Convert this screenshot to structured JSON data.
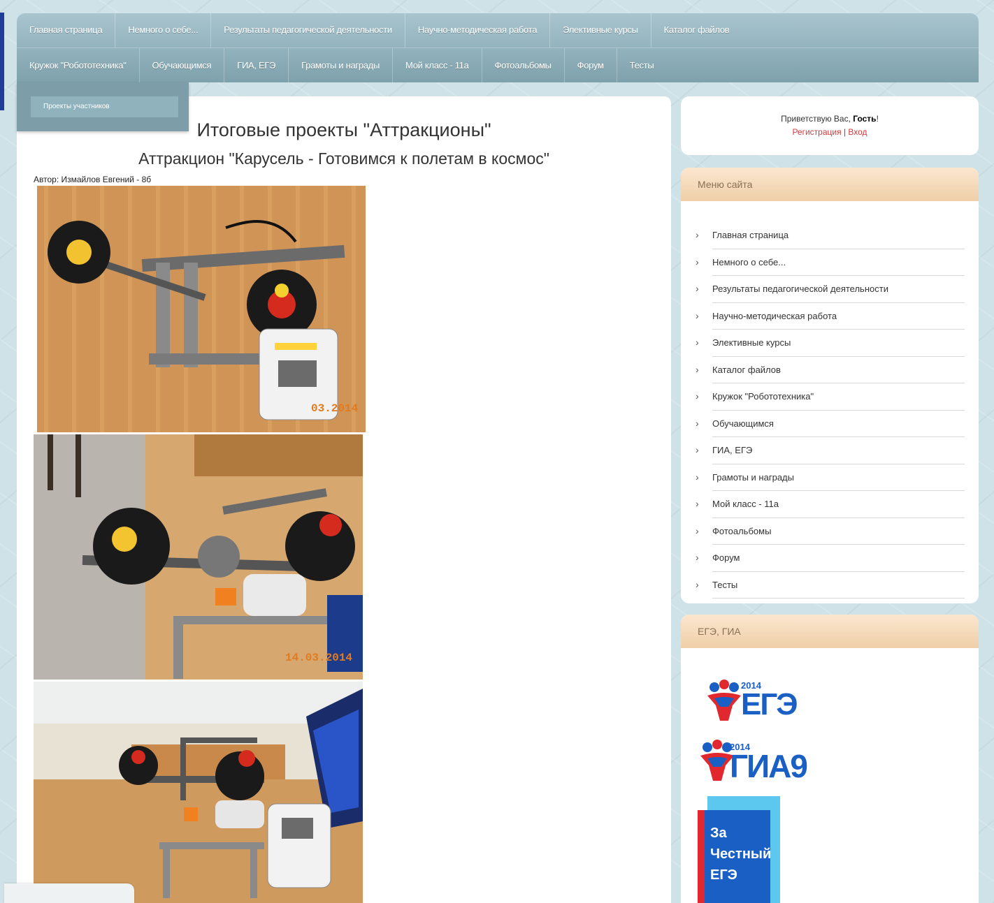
{
  "nav": {
    "row1": [
      "Главная страница",
      "Немного о себе...",
      "Результаты педагогической деятельности",
      "Научно-методическая работа",
      "Элективные курсы",
      "Каталог файлов"
    ],
    "row2": [
      "Кружок \"Робототехника\"",
      "Обучающимся",
      "ГИА, ЕГЭ",
      "Грамоты и награды",
      "Мой класс - 11а",
      "Фотоальбомы",
      "Форум",
      "Тесты"
    ]
  },
  "submenu": {
    "item": "Проекты участников"
  },
  "main": {
    "title": "Итоговые проекты \"Аттракционы\"",
    "subtitle": "Аттракцион \"Карусель - Готовимся к полетам в космос\"",
    "author": "Автор: Измайлов Евгений - 8б",
    "photo_dates": [
      "03.2014",
      "14.03.2014"
    ]
  },
  "sidebar": {
    "greeting_prefix": "Приветствую Вас, ",
    "greeting_name": "Гость",
    "greeting_suffix": "!",
    "register": "Регистрация",
    "separator": "|",
    "login": "Вход",
    "menu_title": "Меню сайта",
    "menu_items": [
      "Главная страница",
      "Немного о себе...",
      "Результаты педагогической деятельности",
      "Научно-методическая работа",
      "Элективные курсы",
      "Каталог файлов",
      "Кружок \"Робототехника\"",
      "Обучающимся",
      "ГИА, ЕГЭ",
      "Грамоты и награды",
      "Мой класс - 11а",
      "Фотоальбомы",
      "Форум",
      "Тесты"
    ],
    "exam_title": "ЕГЭ, ГИА",
    "logo_ege": {
      "year": "2014",
      "text": "ЕГЭ"
    },
    "logo_gia": {
      "year": "2014",
      "text": "ГИА9"
    },
    "logo_honest": {
      "line1": "За",
      "line2": "Честный",
      "line3": "ЕГЭ"
    }
  },
  "colors": {
    "nav": "#8aaab4",
    "accent_red": "#d13a3a",
    "logo_blue": "#1a5fc4",
    "logo_red": "#e0282e"
  }
}
